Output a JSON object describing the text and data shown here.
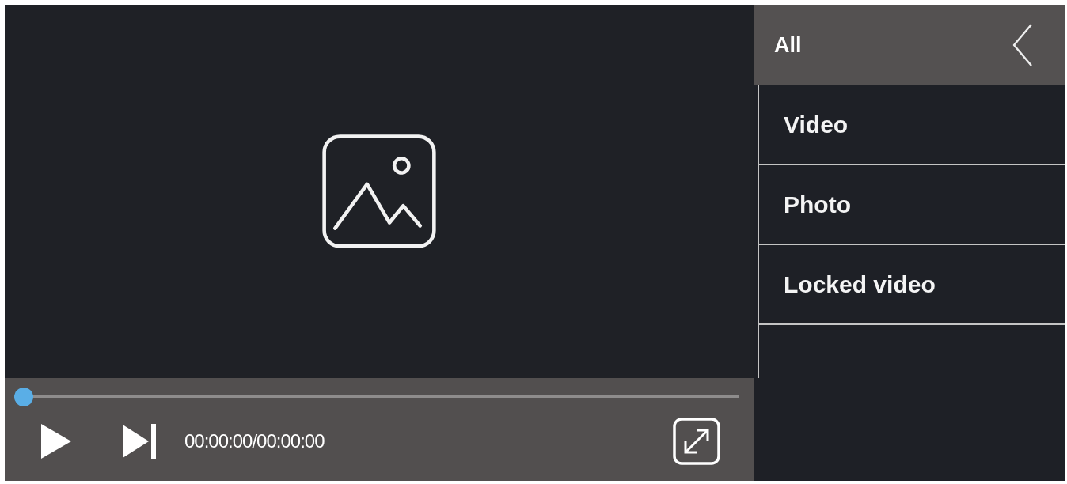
{
  "player": {
    "playing": false,
    "progress": {
      "level": 0
    },
    "timecode": "00:00:00/00:00:00"
  },
  "sidebar": {
    "header": "All",
    "items": [
      {
        "label": "Video",
        "selected": false
      },
      {
        "label": "Photo",
        "selected": false
      },
      {
        "label": "Locked video",
        "selected": false
      }
    ]
  }
}
